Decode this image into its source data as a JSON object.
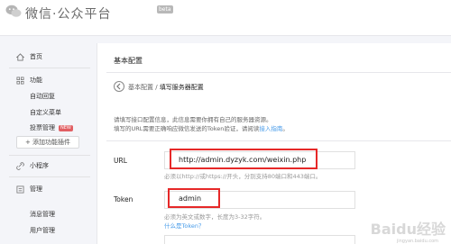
{
  "header": {
    "logo_text": "微信·公众平台",
    "beta": "beta"
  },
  "sidebar": {
    "home": "首页",
    "functions": "功能",
    "auto_reply": "自动回复",
    "custom_menu": "自定义菜单",
    "vote": "投票管理",
    "vote_badge": "NEW",
    "add_plugin": "+ 添加功能插件",
    "mini_program": "小程序",
    "manage": "管理",
    "message_manage": "消息管理",
    "user_manage": "用户管理"
  },
  "main": {
    "page_title": "基本配置",
    "breadcrumb_parent": "基本配置",
    "breadcrumb_sep": " / ",
    "breadcrumb_current": "填写服务器配置",
    "desc_line1": "请填写接口配置信息，此信息需要你拥有自己的服务器资源。",
    "desc_line2_prefix": "填写的URL需要正确响应微信发送的Token验证，请阅读",
    "desc_link": "接入指南",
    "desc_line2_suffix": "。",
    "url_label": "URL",
    "url_value": "http://admin.dyzyk.com/weixin.php",
    "url_hint": "必须以http://或https://开头，分别支持80端口和443端口。",
    "token_label": "Token",
    "token_value": "admin",
    "token_hint": "必须为英文或数字，长度为3-32字符。",
    "token_help": "什么是Token？"
  },
  "watermark": {
    "text": "Baidu经验",
    "sub": "jingyan.baidu.com"
  },
  "colors": {
    "accent_link": "#459ae9",
    "highlight_red": "#e62828",
    "sidebar_bg": "#f4f5f9",
    "badge_red": "#e15f63"
  }
}
